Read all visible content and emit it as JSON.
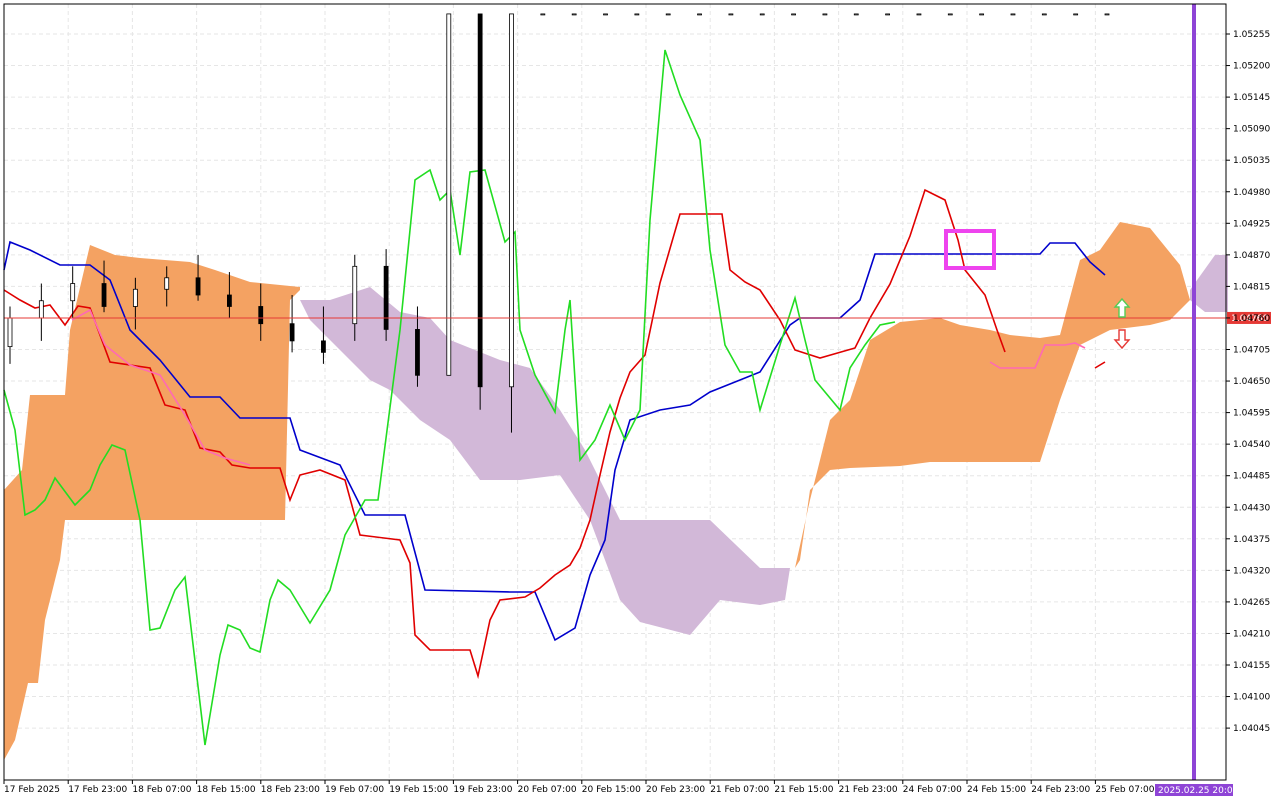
{
  "chart_data": {
    "type": "candlestick",
    "instrument_note": "",
    "y_axis": {
      "range": [
        1.0401,
        1.0529
      ],
      "tick_labels": [
        "1.05255",
        "1.05200",
        "1.05145",
        "1.05090",
        "1.05035",
        "1.04980",
        "1.04925",
        "1.04870",
        "1.04815",
        "1.04760",
        "1.04705",
        "1.04650",
        "1.04595",
        "1.04540",
        "1.04485",
        "1.04430",
        "1.04375",
        "1.04320",
        "1.04265",
        "1.04210",
        "1.04155",
        "1.04100",
        "1.04045"
      ]
    },
    "x_axis": {
      "tick_labels": [
        "17 Feb 2025",
        "17 Feb 23:00",
        "18 Feb 07:00",
        "18 Feb 15:00",
        "18 Feb 23:00",
        "19 Feb 07:00",
        "19 Feb 15:00",
        "19 Feb 23:00",
        "20 Feb 07:00",
        "20 Feb 15:00",
        "20 Feb 23:00",
        "21 Feb 07:00",
        "21 Feb 15:00",
        "21 Feb 23:00",
        "24 Feb 07:00",
        "24 Feb 15:00",
        "24 Feb 23:00",
        "25 Feb 07:00"
      ]
    },
    "grid": true,
    "current_price": {
      "label": "1.04760",
      "value": 1.0476,
      "color": "#e53935"
    },
    "time_marker": {
      "label": "2025.02.25 20:00",
      "color": "#8e44d6"
    },
    "colors": {
      "bull_body": "#ffffff",
      "bear_body": "#000000",
      "highlight_body": "#2a63a8",
      "tenkan": "#e00000",
      "kijun": "#0000cc",
      "chikou": "#22dd22",
      "ma_pink": "#ff69b4",
      "cloud_bull": "#f4a262",
      "cloud_bear": "#d2b8d8",
      "box": "#ee44ee",
      "arrow_up": "#55cc55",
      "arrow_down": "#e53935"
    },
    "candles": [
      [
        1.0471,
        1.0478,
        1.0468,
        1.0476
      ],
      [
        1.0476,
        1.0482,
        1.0472,
        1.0479
      ],
      [
        1.0479,
        1.0485,
        1.0476,
        1.0482
      ],
      [
        1.0482,
        1.0486,
        1.0477,
        1.0478
      ],
      [
        1.0478,
        1.0483,
        1.0474,
        1.0481
      ],
      [
        1.0481,
        1.0485,
        1.0478,
        1.0483
      ],
      [
        1.0483,
        1.0487,
        1.0479,
        1.048
      ],
      [
        1.048,
        1.0484,
        1.0476,
        1.0478
      ],
      [
        1.0478,
        1.0482,
        1.0472,
        1.0475
      ],
      [
        1.0475,
        1.048,
        1.047,
        1.0472
      ],
      [
        1.0472,
        1.0478,
        1.0468,
        1.047
      ],
      [
        1.0475,
        1.0487,
        1.0472,
        1.0485
      ],
      [
        1.0485,
        1.0488,
        1.0472,
        1.0474
      ],
      [
        1.0474,
        1.0478,
        1.0464,
        1.0466
      ],
      [
        1.0466,
        1.047,
        1.066,
        1.0668
      ],
      [
        1.0668,
        1.0676,
        1.046,
        1.0464
      ],
      [
        1.0464,
        1.067,
        1.0456,
        1.066
      ],
      [
        1.066,
        1.0666,
        1.0654,
        1.0658
      ],
      [
        1.0658,
        1.0664,
        1.0652,
        1.0655
      ],
      [
        1.0655,
        1.066,
        1.0648,
        1.065
      ],
      [
        1.065,
        1.0664,
        1.0646,
        1.066
      ],
      [
        1.066,
        1.0668,
        1.0652,
        1.0654
      ],
      [
        1.0654,
        1.0658,
        1.0642,
        1.0646
      ],
      [
        1.0646,
        1.065,
        1.0612,
        1.062
      ],
      [
        1.062,
        1.0625,
        1.0612,
        1.0618
      ],
      [
        1.0618,
        1.0622,
        1.06,
        1.0605
      ],
      [
        1.0605,
        1.061,
        1.0598,
        1.0604
      ],
      [
        1.0604,
        1.0608,
        1.0596,
        1.0598
      ],
      [
        1.0598,
        1.0605,
        1.0594,
        1.06
      ],
      [
        1.06,
        1.0608,
        1.0596,
        1.0605
      ],
      [
        1.0605,
        1.061,
        1.06,
        1.0602
      ],
      [
        1.0602,
        1.0608,
        1.0598,
        1.0606
      ],
      [
        1.0606,
        1.0612,
        1.0602,
        1.0609
      ],
      [
        1.0609,
        1.0616,
        1.0604,
        1.0612
      ],
      [
        1.0612,
        1.0618,
        1.0608,
        1.0615
      ],
      [
        1.0615,
        1.062,
        1.061,
        1.0617
      ]
    ],
    "candles_note": "",
    "series": []
  }
}
